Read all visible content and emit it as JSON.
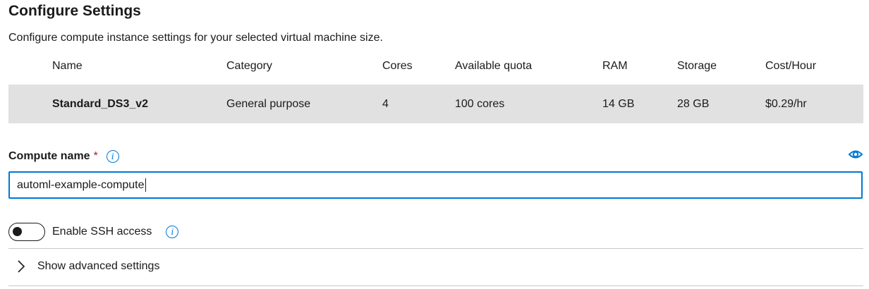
{
  "page": {
    "title": "Configure Settings",
    "subtitle": "Configure compute instance settings for your selected virtual machine size."
  },
  "vm_table": {
    "headers": [
      "Name",
      "Category",
      "Cores",
      "Available quota",
      "RAM",
      "Storage",
      "Cost/Hour"
    ],
    "selected_row": [
      "Standard_DS3_v2",
      "General purpose",
      "4",
      "100 cores",
      "14 GB",
      "28 GB",
      "$0.29/hr"
    ]
  },
  "compute_name": {
    "label": "Compute name",
    "required_marker": "*",
    "value": "automl-example-compute",
    "info_icon": "info-icon",
    "visibility_icon": "eye-icon"
  },
  "ssh": {
    "label": "Enable SSH access",
    "enabled": false,
    "info_icon": "info-icon"
  },
  "advanced": {
    "label": "Show advanced settings",
    "icon": "chevron-right-icon"
  },
  "colors": {
    "accent": "#0078d4",
    "selected_row_bg": "#e1e1e1",
    "required": "#a4262c"
  }
}
